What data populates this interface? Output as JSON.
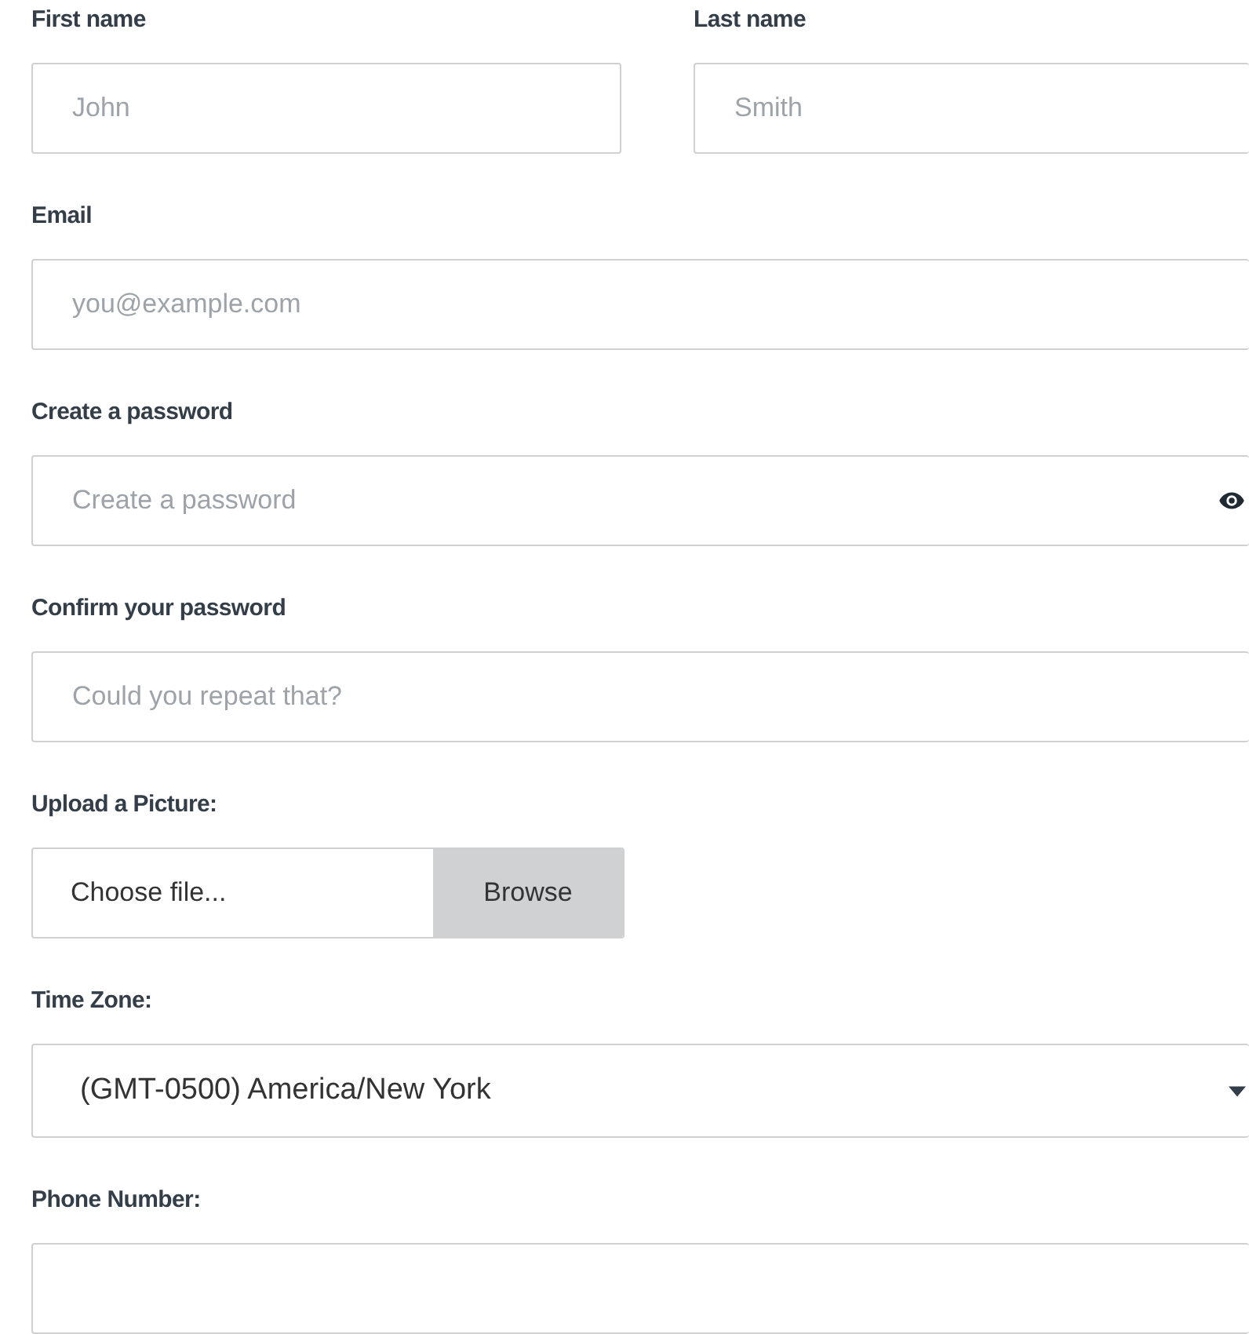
{
  "fields": [
    {
      "kind": "text",
      "label": "First name",
      "placeholder": "John"
    },
    {
      "kind": "text",
      "label": "Last name",
      "placeholder": "Smith"
    },
    {
      "kind": "text",
      "label": "Email",
      "placeholder": "you@example.com"
    },
    {
      "kind": "password",
      "label": "Create a password",
      "placeholder": "Create a password"
    },
    {
      "kind": "text",
      "label": "Confirm your password",
      "placeholder": "Could you repeat that?"
    },
    {
      "kind": "file",
      "label": "Upload a Picture:",
      "value": "Choose file...",
      "button": "Browse"
    },
    {
      "kind": "select",
      "label": "Time Zone:",
      "value": "(GMT-0500) America/New York"
    },
    {
      "kind": "text",
      "label": "Phone Number:"
    }
  ]
}
